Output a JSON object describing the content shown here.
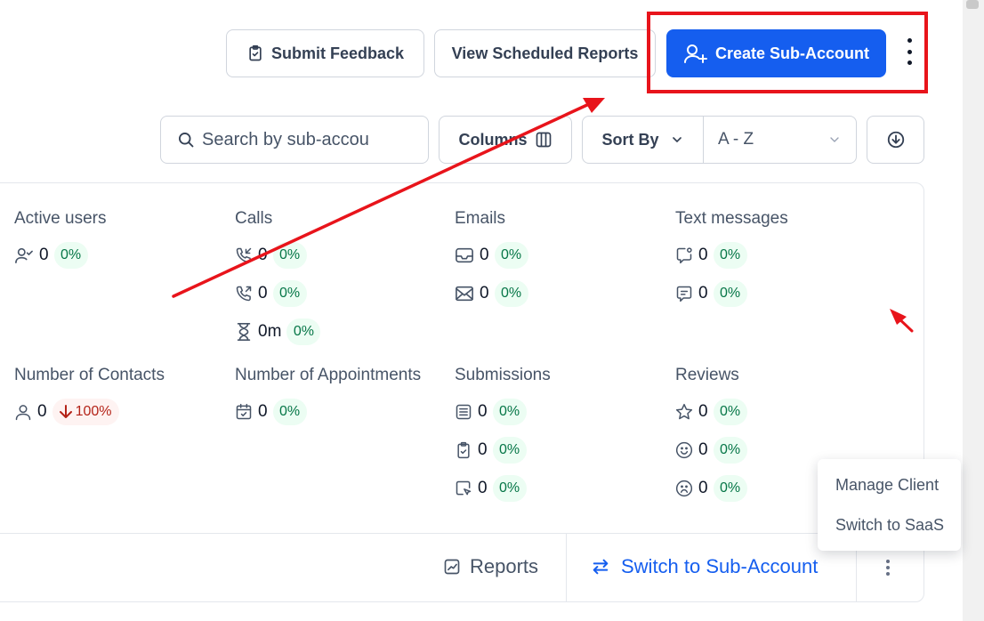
{
  "header": {
    "submit_feedback": "Submit Feedback",
    "view_scheduled_reports": "View Scheduled Reports",
    "create_sub_account": "Create Sub-Account"
  },
  "toolbar": {
    "search_placeholder": "Search by sub-accou",
    "columns_label": "Columns",
    "sort_by_label": "Sort By",
    "sort_value": "A - Z"
  },
  "metrics": {
    "active_users": {
      "title": "Active users",
      "rows": [
        {
          "icon": "user-check-icon",
          "value": "0",
          "pct": "0%"
        }
      ]
    },
    "calls": {
      "title": "Calls",
      "rows": [
        {
          "icon": "phone-incoming-icon",
          "value": "0",
          "pct": "0%"
        },
        {
          "icon": "phone-outgoing-icon",
          "value": "0",
          "pct": "0%"
        },
        {
          "icon": "hourglass-icon",
          "value": "0m",
          "pct": "0%"
        }
      ]
    },
    "emails": {
      "title": "Emails",
      "rows": [
        {
          "icon": "inbox-icon",
          "value": "0",
          "pct": "0%"
        },
        {
          "icon": "mail-icon",
          "value": "0",
          "pct": "0%"
        }
      ]
    },
    "text_messages": {
      "title": "Text messages",
      "rows": [
        {
          "icon": "message-incoming-icon",
          "value": "0",
          "pct": "0%"
        },
        {
          "icon": "message-outgoing-icon",
          "value": "0",
          "pct": "0%"
        }
      ]
    },
    "contacts": {
      "title": "Number of Contacts",
      "rows": [
        {
          "icon": "user-icon",
          "value": "0",
          "pct": "100%"
        }
      ]
    },
    "appointments": {
      "title": "Number of Appointments",
      "rows": [
        {
          "icon": "calendar-check-icon",
          "value": "0",
          "pct": "0%"
        }
      ]
    },
    "submissions": {
      "title": "Submissions",
      "rows": [
        {
          "icon": "form-icon",
          "value": "0",
          "pct": "0%"
        },
        {
          "icon": "clipboard-check-icon",
          "value": "0",
          "pct": "0%"
        },
        {
          "icon": "survey-icon",
          "value": "0",
          "pct": "0%"
        }
      ]
    },
    "reviews": {
      "title": "Reviews",
      "rows": [
        {
          "icon": "star-icon",
          "value": "0",
          "pct": "0%"
        },
        {
          "icon": "smile-icon",
          "value": "0",
          "pct": "0%"
        },
        {
          "icon": "frown-icon",
          "value": "0",
          "pct": "0%"
        }
      ]
    }
  },
  "footer": {
    "reports_label": "Reports",
    "switch_label": "Switch to Sub-Account"
  },
  "dropdown": {
    "items": [
      "Manage Client",
      "Switch to SaaS"
    ]
  },
  "colors": {
    "primary": "#155eef",
    "annotation": "#e8141b",
    "positive_bg": "#ecfdf3",
    "positive_text": "#067647",
    "negative_bg": "#fef3f2",
    "negative_text": "#b42318"
  }
}
